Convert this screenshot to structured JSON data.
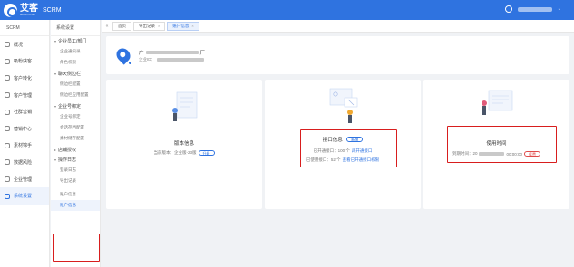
{
  "topbar": {
    "logo_name": "艾客",
    "logo_sub": "aikesrm.com",
    "app_name": "SCRM",
    "user_name": "",
    "user_caret": "⌄"
  },
  "sidebar": {
    "title": "SCRM",
    "items": [
      {
        "label": "概况",
        "icon": "home-icon"
      },
      {
        "label": "吸粉获客",
        "icon": "user-add-icon"
      },
      {
        "label": "客户转化",
        "icon": "convert-icon"
      },
      {
        "label": "客户管理",
        "icon": "customer-icon"
      },
      {
        "label": "社群营销",
        "icon": "group-icon"
      },
      {
        "label": "营销中心",
        "icon": "marketing-icon"
      },
      {
        "label": "素材锦手",
        "icon": "material-icon"
      },
      {
        "label": "数据风险",
        "icon": "data-icon"
      },
      {
        "label": "企业管理",
        "icon": "enterprise-icon"
      },
      {
        "label": "系统设置",
        "icon": "settings-icon"
      }
    ]
  },
  "subnav": {
    "title": "系统设置",
    "groups": [
      {
        "label": "企业员工/部门",
        "items": [
          "企业通讯录",
          "角色权限"
        ]
      },
      {
        "label": "聊天侧边栏",
        "items": [
          "侧边栏配置",
          "侧边栏应用配置"
        ]
      },
      {
        "label": "企业号绑定",
        "items": [
          "企业号绑定",
          "会话存档配置",
          "素材储存配置"
        ]
      },
      {
        "label": "店铺授权",
        "items": []
      },
      {
        "label": "操作日志",
        "items": [
          "登录日志",
          "导出记录"
        ]
      }
    ],
    "extra_items": [
      "账户信息",
      "账户信息"
    ],
    "collapse_glyph": "‹"
  },
  "tabs": {
    "prev_glyph": "«",
    "items": [
      {
        "label": "首页"
      },
      {
        "label": "导出记录"
      },
      {
        "label": "账户信息"
      }
    ],
    "close_glyph": "×"
  },
  "company": {
    "name_prefix": "广",
    "name_suffix": "厂",
    "id_label": "企业ID："
  },
  "cards": {
    "version": {
      "title": "版本信息",
      "line_prefix": "当前版本：企业版-23版",
      "action": "升级"
    },
    "interface": {
      "title": "接口信息",
      "badge": "新增",
      "line1_prefix": "已开通接口：100 个",
      "line1_link": "再开通接口",
      "line2_prefix": "已使用接口：52 个",
      "line2_link": "查看已开通接口权限"
    },
    "usage": {
      "title": "使用时间",
      "line_prefix": "到期时间：20",
      "line_suffix": "00:00:00",
      "badge": "续费"
    }
  },
  "colors": {
    "brand": "#2f73e0",
    "highlight": "#d81e1e",
    "accent_red": "#e04b4b"
  }
}
